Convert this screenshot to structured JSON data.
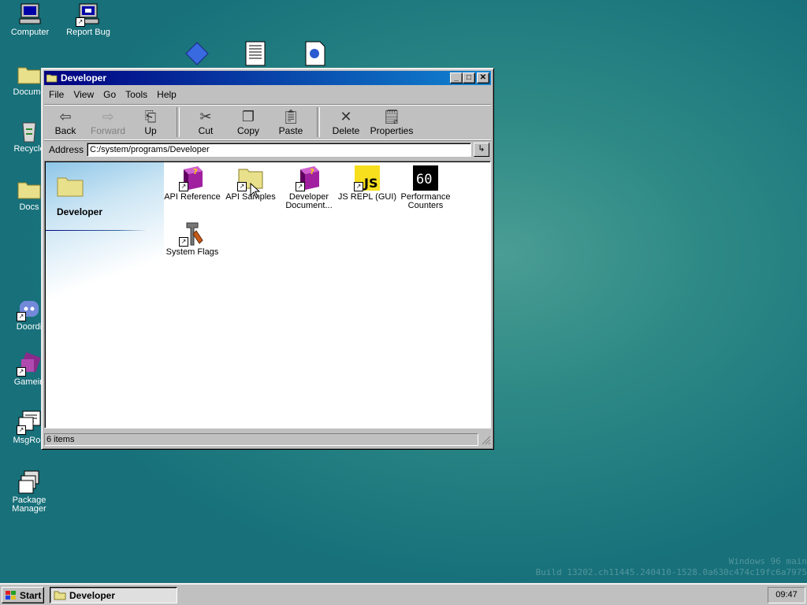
{
  "desktop": {
    "icons": [
      {
        "label": "Computer",
        "icon": "computer-icon"
      },
      {
        "label": "Report Bug",
        "icon": "report-bug-icon"
      },
      {
        "label": "Docume",
        "icon": "documents-folder-icon"
      },
      {
        "label": "Recycle",
        "icon": "recycle-bin-icon"
      },
      {
        "label": "Docs",
        "icon": "docs-folder-icon"
      },
      {
        "label": "Doordi",
        "icon": "discord-icon"
      },
      {
        "label": "Gamein",
        "icon": "game-icon"
      },
      {
        "label": "MsgRoo",
        "icon": "msgroom-icon"
      },
      {
        "label": "Package Manager",
        "icon": "package-manager-icon"
      }
    ],
    "watermark": {
      "line1": "Windows 96 main",
      "line2": "Build 13202.ch11445.240410-1528.0a630c474c19fc6a7975"
    }
  },
  "window": {
    "title": "Developer",
    "menu": [
      "File",
      "View",
      "Go",
      "Tools",
      "Help"
    ],
    "toolbar": {
      "back": "Back",
      "forward": "Forward",
      "up": "Up",
      "cut": "Cut",
      "copy": "Copy",
      "paste": "Paste",
      "delete": "Delete",
      "properties": "Properties"
    },
    "address": {
      "label": "Address",
      "value": "C:/system/programs/Developer"
    },
    "side_panel_title": "Developer",
    "items": [
      {
        "label": "API Reference",
        "icon": "help-book-icon"
      },
      {
        "label": "API Samples",
        "icon": "folder-icon"
      },
      {
        "label": "Developer Document...",
        "icon": "help-book-icon"
      },
      {
        "label": "JS REPL (GUI)",
        "icon": "js-icon"
      },
      {
        "label": "Performance Counters",
        "icon": "fps-counter-icon",
        "badge": "60"
      },
      {
        "label": "System Flags",
        "icon": "tools-icon"
      }
    ],
    "status": "6 items"
  },
  "taskbar": {
    "start": "Start",
    "task": "Developer",
    "clock": "09:47"
  }
}
